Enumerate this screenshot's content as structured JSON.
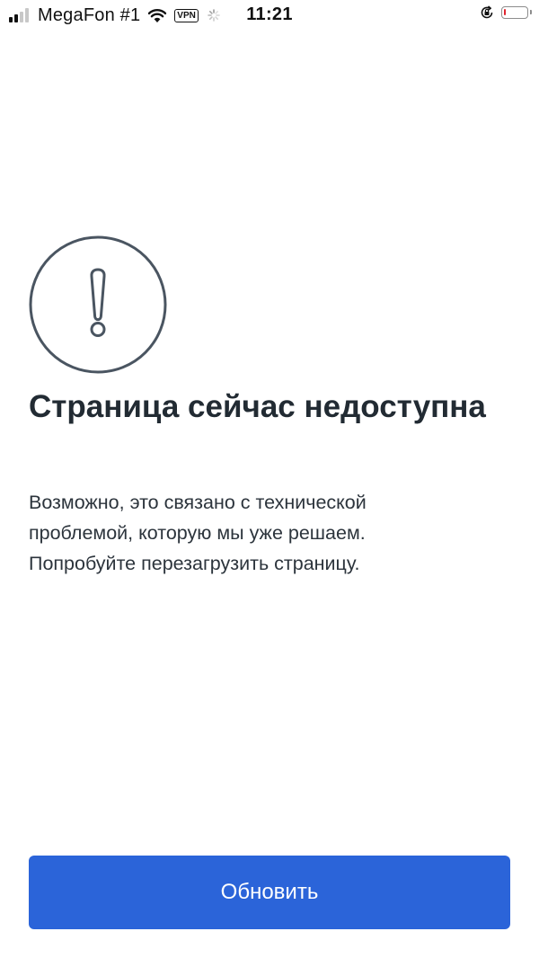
{
  "status_bar": {
    "carrier": "MegaFon #1",
    "vpn_label": "VPN",
    "time": "11:21",
    "battery_level": 0.1,
    "battery_color": "#e0242e",
    "icons": [
      "signal-icon",
      "wifi-icon",
      "vpn-icon",
      "loading-spinner-icon",
      "rotation-lock-icon",
      "battery-icon"
    ]
  },
  "error_page": {
    "icon": "exclamation-circle-icon",
    "title": "Страница сейчас недоступна",
    "description_lines": [
      "Возможно, это связано с технической",
      "проблемой, которую мы уже решаем.",
      "Попробуйте перезагрузить страницу."
    ],
    "refresh_label": "Обновить"
  },
  "colors": {
    "accent": "#2b64d9",
    "text_primary": "#222b33",
    "icon_stroke": "#4a5561"
  }
}
